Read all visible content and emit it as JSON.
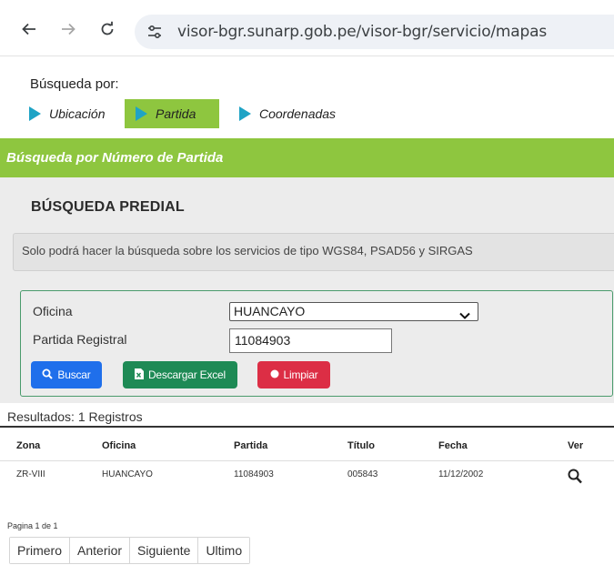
{
  "browser": {
    "url": "visor-bgr.sunarp.gob.pe/visor-bgr/servicio/mapas"
  },
  "search": {
    "label": "Búsqueda por:",
    "modes": [
      "Ubicación",
      "Partida",
      "Coordenadas"
    ],
    "active_mode": "Partida"
  },
  "panel": {
    "header": "Búsqueda por Número de Partida",
    "section_title": "BÚSQUEDA PREDIAL",
    "notice": "Solo podrá hacer la búsqueda sobre los servicios de tipo WGS84, PSAD56 y SIRGAS"
  },
  "form": {
    "office_label": "Oficina",
    "office_value": "HUANCAYO",
    "partida_label": "Partida Registral",
    "partida_value": "11084903",
    "buttons": {
      "search": "Buscar",
      "excel": "Descargar Excel",
      "clear": "Limpiar"
    }
  },
  "results": {
    "count_text": "Resultados: 1 Registros",
    "columns": [
      "Zona",
      "Oficina",
      "Partida",
      "Título",
      "Fecha",
      "Ver"
    ],
    "rows": [
      [
        "ZR-VIII",
        "HUANCAYO",
        "11084903",
        "005843",
        "11/12/2002"
      ]
    ],
    "page_info": "Pagina 1 de 1",
    "pager": [
      "Primero",
      "Anterior",
      "Siguiente",
      "Ultimo"
    ]
  },
  "colors": {
    "green_accent": "#8ec63f",
    "triangle": "#1fa3c5",
    "primary_button": "#1f6feb",
    "excel_button": "#1e8a55",
    "clear_button": "#dc2e45"
  },
  "icons": {
    "back": "arrow-left-icon",
    "forward": "arrow-right-icon",
    "reload": "reload-icon",
    "site_info": "tune-icon",
    "search": "magnifier-icon",
    "excel": "excel-file-icon",
    "clear": "circle-icon",
    "view": "magnifier-icon"
  }
}
